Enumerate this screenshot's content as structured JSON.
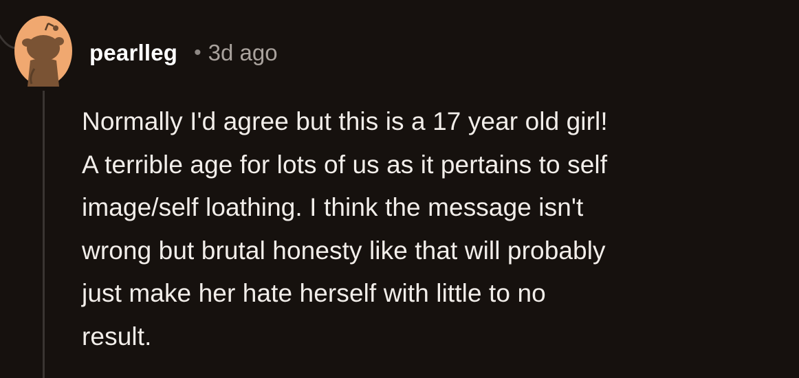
{
  "comment": {
    "author": "pearlleg",
    "separator": "•",
    "timestamp": "3d ago",
    "avatar_icon": "snoo-avatar-icon",
    "body_lines": [
      "Normally I'd agree but this is a 17 year old girl!",
      "A terrible age for lots of us as it pertains to self",
      "image/self loathing. I think the message isn't",
      "wrong but brutal honesty like that will probably",
      "just make her hate herself with little to no",
      "result."
    ]
  },
  "colors": {
    "background": "#16110e",
    "avatar_bg": "#f0a870",
    "avatar_figure": "#7a5334",
    "username": "#ffffff",
    "timestamp": "#a9a29d",
    "body_text": "#f2eeea",
    "thread_line": "#3a3532"
  }
}
